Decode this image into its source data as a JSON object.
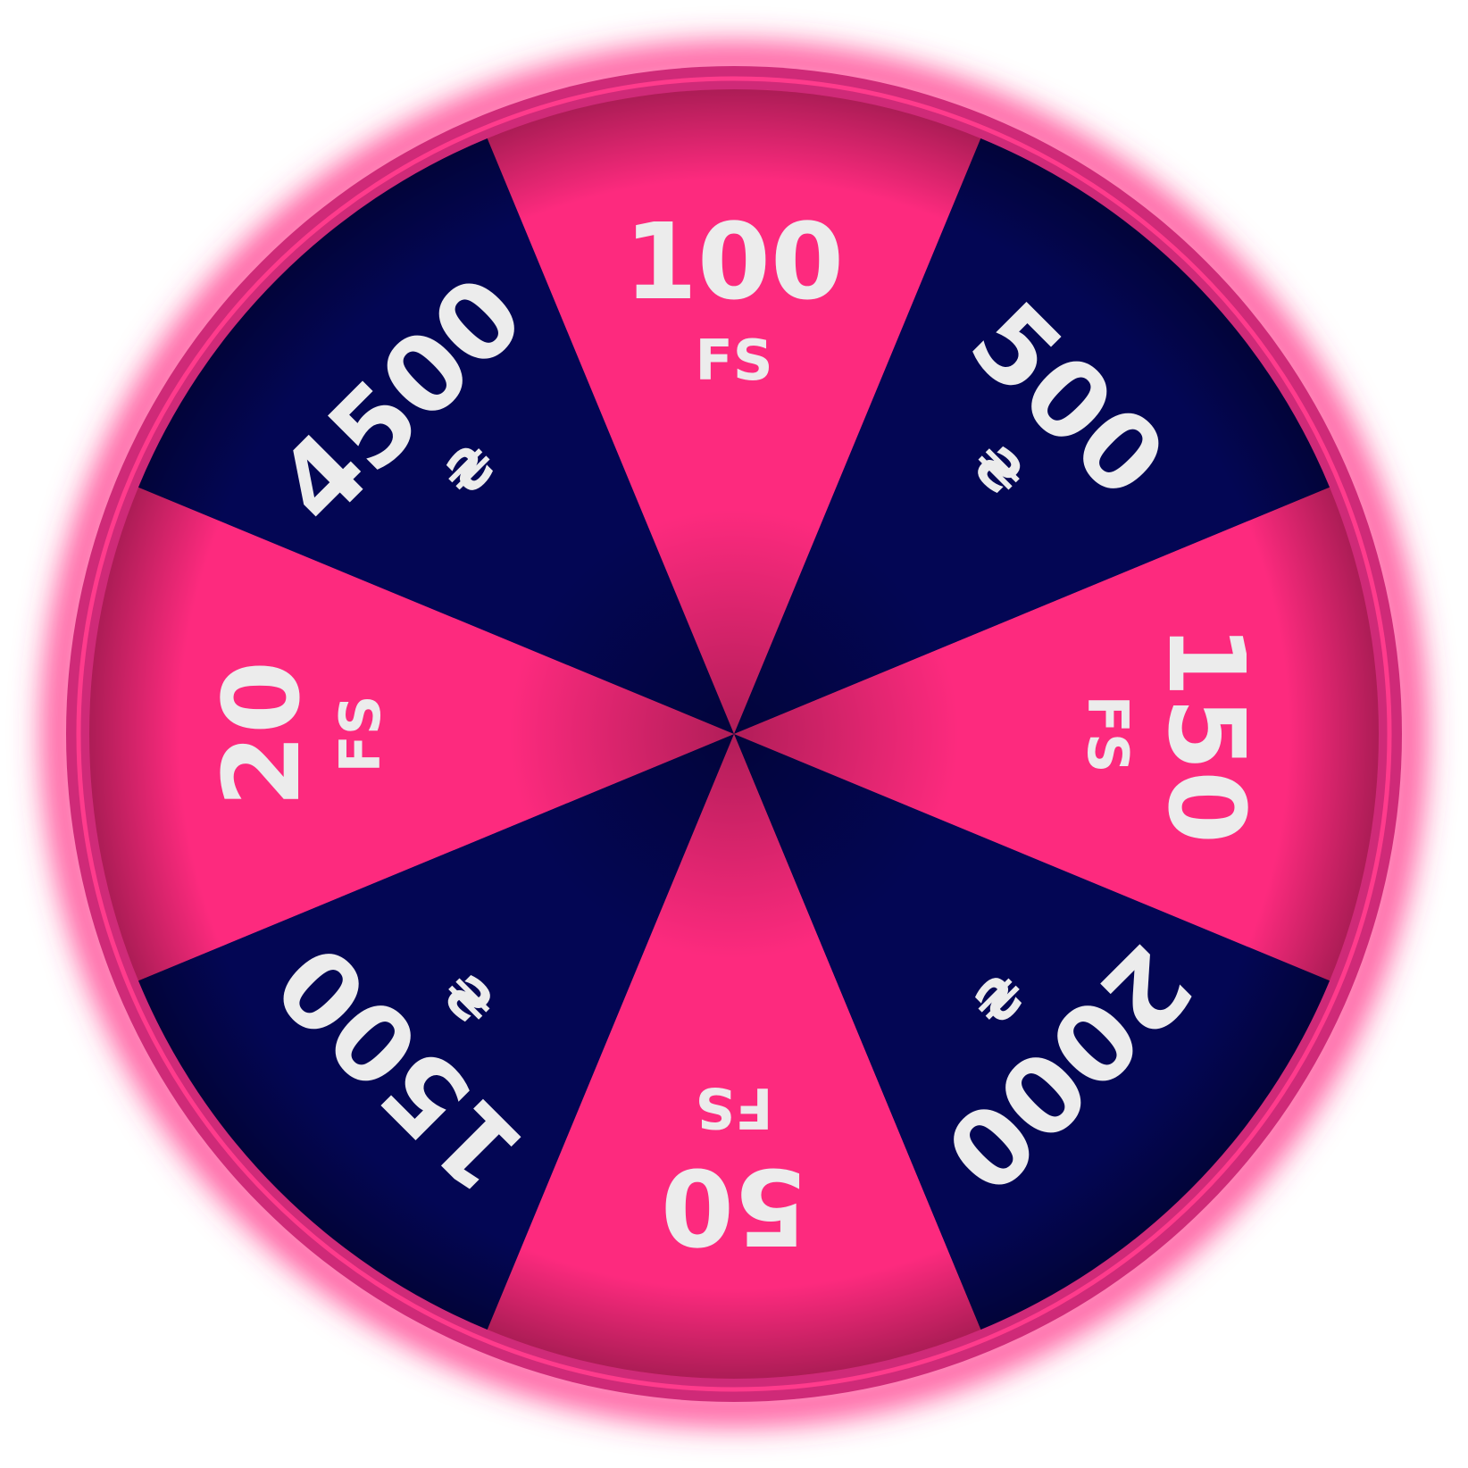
{
  "wheel": {
    "colors": {
      "pink": "#fd2a7e",
      "navy": "#030654",
      "rim": "#cf2a78",
      "rim_inner": "#ff3b8c",
      "glow": "#ff3b8c",
      "text": "#ececec"
    },
    "segments": [
      {
        "value": "100",
        "unit": "FS",
        "color": "pink",
        "icon": "text-label"
      },
      {
        "value": "500",
        "unit": "₴",
        "color": "navy",
        "icon": "hryvnia-icon"
      },
      {
        "value": "150",
        "unit": "FS",
        "color": "pink",
        "icon": "text-label"
      },
      {
        "value": "2000",
        "unit": "₴",
        "color": "navy",
        "icon": "hryvnia-icon"
      },
      {
        "value": "50",
        "unit": "FS",
        "color": "pink",
        "icon": "text-label"
      },
      {
        "value": "1500",
        "unit": "₴",
        "color": "navy",
        "icon": "hryvnia-icon"
      },
      {
        "value": "20",
        "unit": "FS",
        "color": "pink",
        "icon": "text-label"
      },
      {
        "value": "4500",
        "unit": "₴",
        "color": "navy",
        "icon": "hryvnia-icon"
      }
    ]
  }
}
